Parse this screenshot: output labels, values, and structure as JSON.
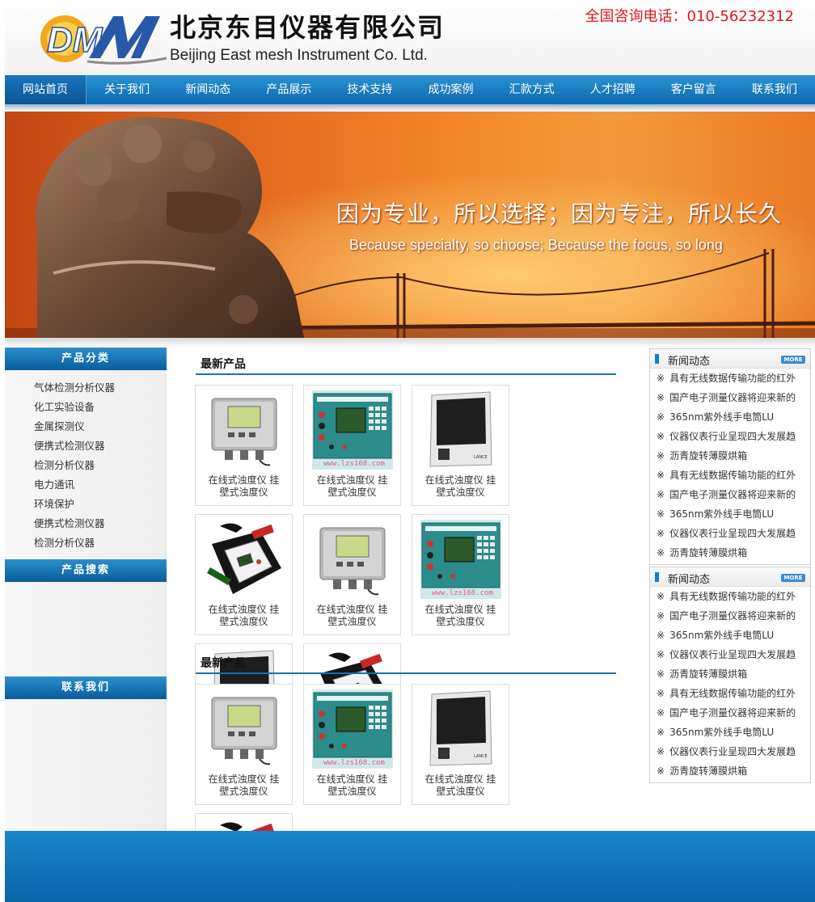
{
  "header": {
    "logo_text": "DM",
    "company_cn": "北京东目仪器有限公司",
    "company_en": "Beijing East mesh Instrument Co. Ltd.",
    "hotline": "全国咨询电话：010-56232312"
  },
  "nav": {
    "items": [
      {
        "label": "网站首页"
      },
      {
        "label": "关于我们"
      },
      {
        "label": "新闻动态"
      },
      {
        "label": "产品展示"
      },
      {
        "label": "技术支持"
      },
      {
        "label": "成功案例"
      },
      {
        "label": "汇款方式"
      },
      {
        "label": "人才招聘"
      },
      {
        "label": "客户留言"
      },
      {
        "label": "联系我们"
      }
    ]
  },
  "banner": {
    "slogan_cn": "因为专业，所以选择；因为专注，所以长久",
    "slogan_en": "Because specialty, so choose; Because the focus, so long"
  },
  "sidebar": {
    "categories_title": "产品分类",
    "categories": [
      "气体检测分析仪器",
      "化工实验设备",
      "金属探测仪",
      "便携式检测仪器",
      "检测分析仪器",
      "电力通讯",
      "环境保护",
      "便携式检测仪器",
      "检测分析仪器"
    ],
    "search_title": "产品搜索",
    "contact_title": "联系我们"
  },
  "main": {
    "section1_title": "最新产品",
    "section2_title": "最新产品",
    "product_caption_line1": "在线式浊度仪 挂",
    "product_caption_line2": "壁式浊度仪",
    "watermark": "www.lzs168.com",
    "device_brand": "LANCE"
  },
  "news": {
    "title": "新闻动态",
    "more_label": "MORE",
    "mark": "※",
    "items": [
      "具有无线数据传输功能的红外",
      "国产电子测量仪器将迎来新的",
      "365nm紫外线手电筒LU",
      "仪器仪表行业呈现四大发展趋",
      "沥青旋转薄膜烘箱",
      "具有无线数据传输功能的红外",
      "国产电子测量仪器将迎来新的",
      "365nm紫外线手电筒LU",
      "仪器仪表行业呈现四大发展趋",
      "沥青旋转薄膜烘箱"
    ]
  },
  "colors": {
    "nav_blue": "#0c68ad",
    "hotline_red": "#e3171b",
    "accent_blue": "#1b6fb0"
  }
}
